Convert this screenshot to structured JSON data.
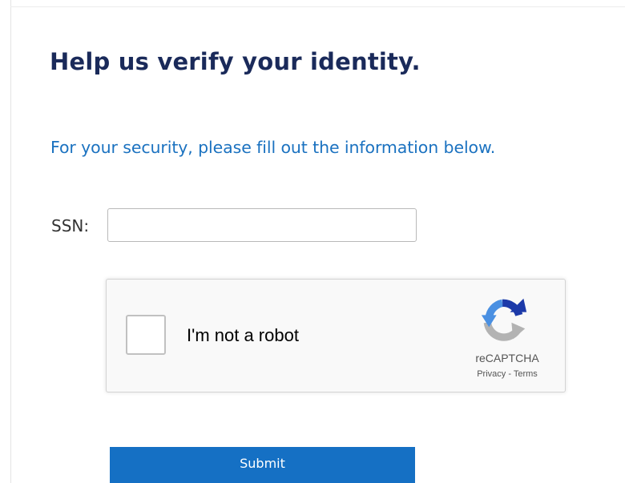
{
  "form": {
    "heading": "Help us verify your identity.",
    "subtitle": "For your security, please fill out the information below.",
    "ssn_label": "SSN:",
    "ssn_value": "",
    "ssn_placeholder": ""
  },
  "captcha": {
    "label": "I'm not a robot",
    "brand": "reCAPTCHA",
    "privacy_link": "Privacy",
    "separator": " - ",
    "terms_link": "Terms",
    "checked": false
  },
  "submit": {
    "label": "Submit"
  },
  "colors": {
    "heading": "#1a2a5a",
    "subtitle": "#1b72c0",
    "submit_bg": "#1570c4",
    "recaptcha_blue": "#4a90e2",
    "recaptcha_navy": "#1c3aa9",
    "recaptcha_gray": "#b3b3b3"
  },
  "icons": {
    "captcha_logo": "recaptcha-logo-icon"
  }
}
